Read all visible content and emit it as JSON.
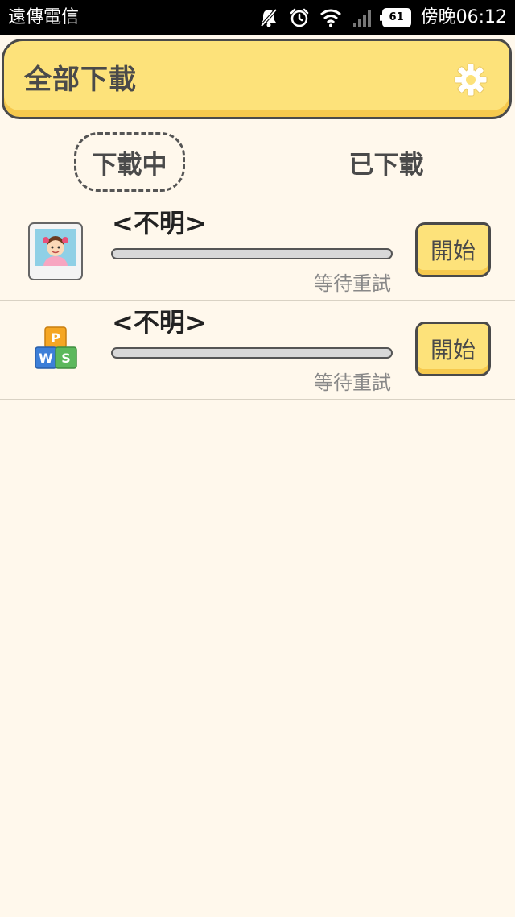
{
  "status_bar": {
    "carrier": "遠傳電信",
    "battery": "61",
    "time": "傍晚06:12"
  },
  "header": {
    "title": "全部下載",
    "settings_icon": "gear-icon"
  },
  "tabs": [
    {
      "label": "下載中",
      "active": true
    },
    {
      "label": "已下載",
      "active": false
    }
  ],
  "downloads": [
    {
      "icon": "photo-app-icon",
      "name": "<不明>",
      "status": "等待重試",
      "action": "開始",
      "progress": 0
    },
    {
      "icon": "office-app-icon",
      "name": "<不明>",
      "status": "等待重試",
      "action": "開始",
      "progress": 0
    }
  ],
  "colors": {
    "background": "#fff8ec",
    "accent": "#fde27a",
    "border": "#4a4a4a"
  }
}
